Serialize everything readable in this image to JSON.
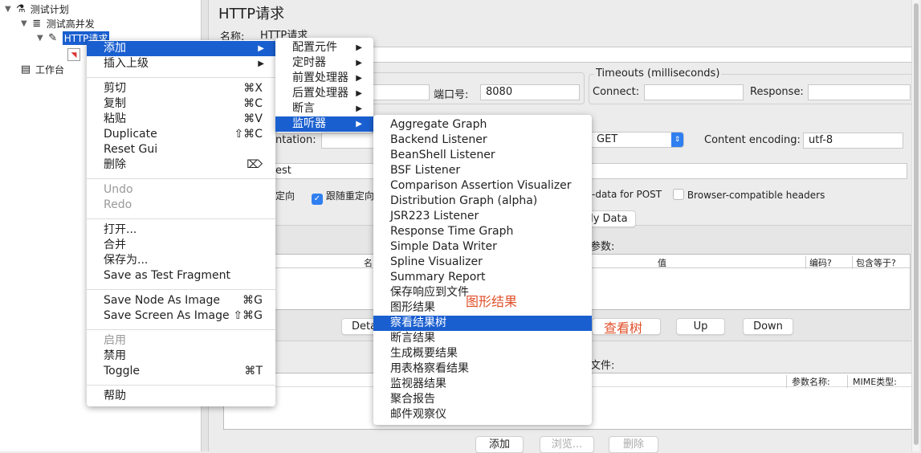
{
  "tree": {
    "plan": "测试计划",
    "thread_group": "测试高并发",
    "http_request": "HTTP请求",
    "workbench": "工作台"
  },
  "panel": {
    "title": "HTTP请求",
    "name_label": "名称:",
    "name_value": "HTTP请求",
    "port_label": "端口号:",
    "port_value": "8080",
    "timeouts_title": "Timeouts (milliseconds)",
    "connect_label": "Connect:",
    "response_label": "Response:",
    "implementation_label": "ntation:",
    "method_value": "GET",
    "encoding_label": "Content encoding:",
    "encoding_value": "utf-8",
    "path_value": "est",
    "redirect_label": "定向",
    "follow_redirect_label": "跟随重定向",
    "follow_redirect_checked": true,
    "multipart_label": "-data for POST",
    "browser_headers_label": "Browser-compatible headers",
    "browser_headers_checked": false,
    "body_data_tab": "dy Data",
    "params_label": "参数:",
    "params_headers": [
      "名",
      "值",
      "编码?",
      "包含等于?"
    ],
    "detail_button": "Deta",
    "up_button": "Up",
    "down_button": "Down",
    "files_label": "文件:",
    "files_headers": [
      "参数名称:",
      "MIME类型:"
    ],
    "add_button": "添加",
    "browse_button": "浏览...",
    "delete_button": "删除"
  },
  "annotations": {
    "graph_results": "图形结果",
    "view_tree": "查看树",
    "color": "#e0502a"
  },
  "context_menu": [
    {
      "label": "添加",
      "submenu": true,
      "highlighted": true
    },
    {
      "label": "插入上级",
      "submenu": true
    },
    {
      "sep": true
    },
    {
      "label": "剪切",
      "shortcut": "⌘X"
    },
    {
      "label": "复制",
      "shortcut": "⌘C"
    },
    {
      "label": "粘贴",
      "shortcut": "⌘V"
    },
    {
      "label": "Duplicate",
      "shortcut": "⇧⌘C"
    },
    {
      "label": "Reset Gui"
    },
    {
      "label": "删除",
      "shortcut": "⌦"
    },
    {
      "sep": true
    },
    {
      "label": "Undo",
      "disabled": true
    },
    {
      "label": "Redo",
      "disabled": true
    },
    {
      "sep": true
    },
    {
      "label": "打开..."
    },
    {
      "label": "合并"
    },
    {
      "label": "保存为..."
    },
    {
      "label": "Save as Test Fragment"
    },
    {
      "sep": true
    },
    {
      "label": "Save Node As Image",
      "shortcut": "⌘G"
    },
    {
      "label": "Save Screen As Image",
      "shortcut": "⇧⌘G"
    },
    {
      "sep": true
    },
    {
      "label": "启用",
      "disabled": true
    },
    {
      "label": "禁用"
    },
    {
      "label": "Toggle",
      "shortcut": "⌘T"
    },
    {
      "sep": true
    },
    {
      "label": "帮助"
    }
  ],
  "add_submenu": [
    {
      "label": "配置元件",
      "submenu": true
    },
    {
      "label": "定时器",
      "submenu": true
    },
    {
      "label": "前置处理器",
      "submenu": true
    },
    {
      "label": "后置处理器",
      "submenu": true
    },
    {
      "label": "断言",
      "submenu": true
    },
    {
      "label": "监听器",
      "submenu": true,
      "highlighted": true
    }
  ],
  "listener_submenu": [
    {
      "label": "Aggregate Graph"
    },
    {
      "label": "Backend Listener"
    },
    {
      "label": "BeanShell Listener"
    },
    {
      "label": "BSF Listener"
    },
    {
      "label": "Comparison Assertion Visualizer"
    },
    {
      "label": "Distribution Graph (alpha)"
    },
    {
      "label": "JSR223 Listener"
    },
    {
      "label": "Response Time Graph"
    },
    {
      "label": "Simple Data Writer"
    },
    {
      "label": "Spline Visualizer"
    },
    {
      "label": "Summary Report"
    },
    {
      "label": "保存响应到文件"
    },
    {
      "label": "图形结果"
    },
    {
      "label": "察看结果树",
      "highlighted": true
    },
    {
      "label": "断言结果"
    },
    {
      "label": "生成概要结果"
    },
    {
      "label": "用表格察看结果"
    },
    {
      "label": "监视器结果"
    },
    {
      "label": "聚合报告"
    },
    {
      "label": "邮件观察仪"
    }
  ]
}
